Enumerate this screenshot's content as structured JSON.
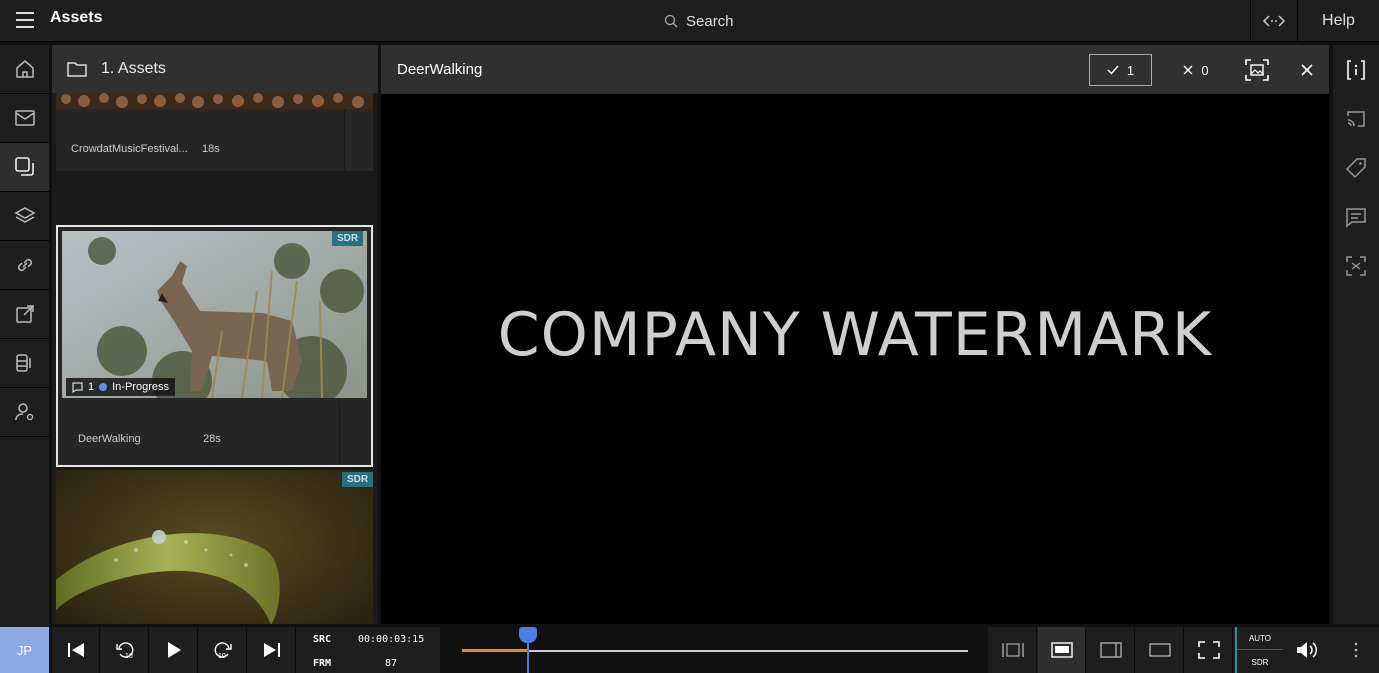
{
  "header": {
    "app_title": "Assets",
    "search_label": "Search",
    "help_label": "Help"
  },
  "user": {
    "initials": "JP"
  },
  "assets_panel": {
    "title": "1. Assets",
    "items": [
      {
        "name": "CrowdatMusicFestival...",
        "duration": "18s"
      },
      {
        "name": "DeerWalking",
        "duration": "28s",
        "badge": "SDR",
        "comment_count": "1",
        "status": "In-Progress"
      },
      {
        "badge": "SDR"
      }
    ]
  },
  "viewer": {
    "title": "DeerWalking",
    "approve_count": "1",
    "reject_count": "0",
    "watermark": "COMPANY WATERMARK"
  },
  "transport": {
    "src_label": "SRC",
    "src_timecode": "00:00:03:15",
    "frm_label": "FRM",
    "frame": "87",
    "progress": 0.13,
    "auto_label": "AUTO",
    "sdr_label": "SDR"
  },
  "colors": {
    "accent": "#4d7fe0",
    "badge": "#2a6f7c",
    "avatar": "#8ea7e6",
    "played": "#e08a2a"
  }
}
